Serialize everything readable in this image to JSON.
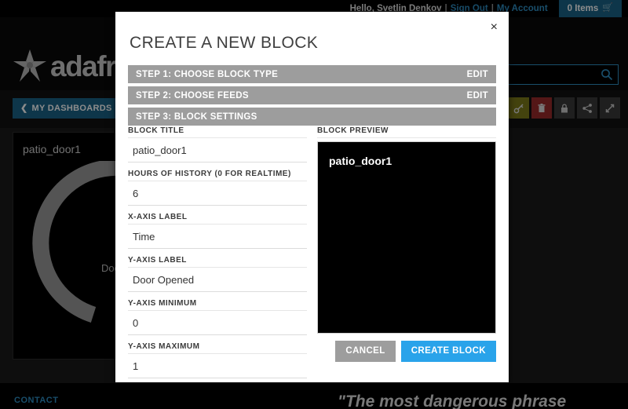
{
  "topbar": {
    "greeting": "Hello, Svetlin Denkov",
    "separator": "|",
    "sign_out": "Sign Out",
    "my_account": "My Account",
    "cart_label": "0 Items",
    "cart_icon": "shopping-cart-icon",
    "link_color": "#2f8fc4",
    "cart_bg": "#1a6387"
  },
  "site_header": {
    "brand": "adafruit",
    "logo_icon": "adafruit-star-icon",
    "search_placeholder": "",
    "search_value": "",
    "search_icon": "search-icon"
  },
  "dashboard_bar": {
    "back_label": "MY DASHBOARDS",
    "back_icon": "chevron-left-icon",
    "tools": [
      {
        "name": "key-icon",
        "color": "#7d7a1a"
      },
      {
        "name": "trash-icon",
        "color": "#9a2b2b"
      },
      {
        "name": "lock-icon",
        "color": "#3a3a3a"
      },
      {
        "name": "share-icon",
        "color": "#3a3a3a"
      },
      {
        "name": "expand-icon",
        "color": "#3a3a3a"
      }
    ]
  },
  "dashboard_canvas": {
    "gauge_block": {
      "title": "patio_door1",
      "axis_label": "Door"
    }
  },
  "footer": {
    "contact": "CONTACT",
    "quote": "\"The most dangerous phrase"
  },
  "modal": {
    "title": "CREATE A NEW BLOCK",
    "close_icon": "close-icon",
    "close_label": "×",
    "steps": [
      {
        "label": "STEP 1: CHOOSE BLOCK TYPE",
        "action": "EDIT"
      },
      {
        "label": "STEP 2: CHOOSE FEEDS",
        "action": "EDIT"
      },
      {
        "label": "STEP 3: BLOCK SETTINGS",
        "action": ""
      }
    ],
    "fields": [
      {
        "label": "BLOCK TITLE",
        "value": "patio_door1",
        "placeholder": ""
      },
      {
        "label": "HOURS OF HISTORY (0 FOR REALTIME)",
        "value": "6",
        "placeholder": ""
      },
      {
        "label": "X-AXIS LABEL",
        "value": "Time",
        "placeholder": ""
      },
      {
        "label": "Y-AXIS LABEL",
        "value": "Door Opened",
        "placeholder": ""
      },
      {
        "label": "Y-AXIS MINIMUM",
        "value": "0",
        "placeholder": ""
      },
      {
        "label": "Y-AXIS MAXIMUM",
        "value": "1",
        "placeholder": ""
      }
    ],
    "preview": {
      "label": "BLOCK PREVIEW",
      "block_title": "patio_door1"
    },
    "cancel_label": "CANCEL",
    "create_label": "CREATE BLOCK",
    "step_bg": "#9d9d9d",
    "create_bg": "#29a3ea",
    "cancel_bg": "#9d9d9d"
  }
}
